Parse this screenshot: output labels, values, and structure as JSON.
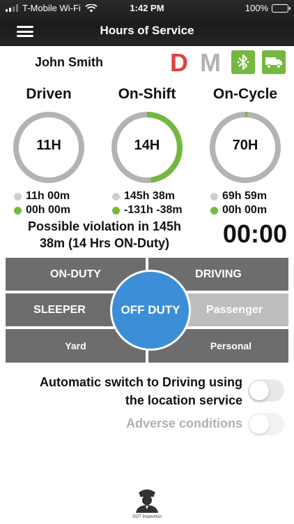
{
  "status_bar": {
    "carrier": "T-Mobile Wi-Fi",
    "time": "1:42 PM",
    "battery": "100%"
  },
  "nav": {
    "title": "Hours of Service",
    "menu_icon": "hamburger-menu-icon"
  },
  "driver": {
    "name": "John Smith",
    "badge_d": "D",
    "badge_m": "M",
    "bluetooth_icon": "bluetooth-icon",
    "truck_icon": "truck-icon"
  },
  "gauges": [
    {
      "label": "Driven",
      "center": "11H",
      "progress": 0.0,
      "row1": "11h 00m",
      "row2": "00h 00m"
    },
    {
      "label": "On-Shift",
      "center": "14H",
      "progress": 0.48,
      "row1": "145h 38m",
      "row2": "-131h -38m"
    },
    {
      "label": "On-Cycle",
      "center": "70H",
      "progress": 0.01,
      "row1": "69h 59m",
      "row2": "00h 00m"
    }
  ],
  "violation": {
    "text": "Possible violation in 145h 38m (14 Hrs ON-Duty)",
    "timer": "00:00"
  },
  "duty_status": {
    "on_duty": "ON-DUTY",
    "driving": "DRIVING",
    "sleeper": "SLEEPER",
    "off_duty": "OFF DUTY",
    "passenger": "Passenger",
    "yard": "Yard",
    "personal": "Personal"
  },
  "settings": {
    "auto_switch": {
      "label": "Automatic switch to Driving using the location service",
      "on": false
    },
    "adverse": {
      "label": "Adverse conditions",
      "on": false
    }
  },
  "dot_inspection": {
    "caption": "DOT Inspection",
    "icon": "officer-icon"
  },
  "colors": {
    "green": "#74b83f",
    "red": "#e0413c",
    "blue": "#3c8ed6",
    "ring_gray": "#b3b3b3",
    "cell_gray": "#6d6d6d",
    "cell_light": "#bdbdbd"
  }
}
